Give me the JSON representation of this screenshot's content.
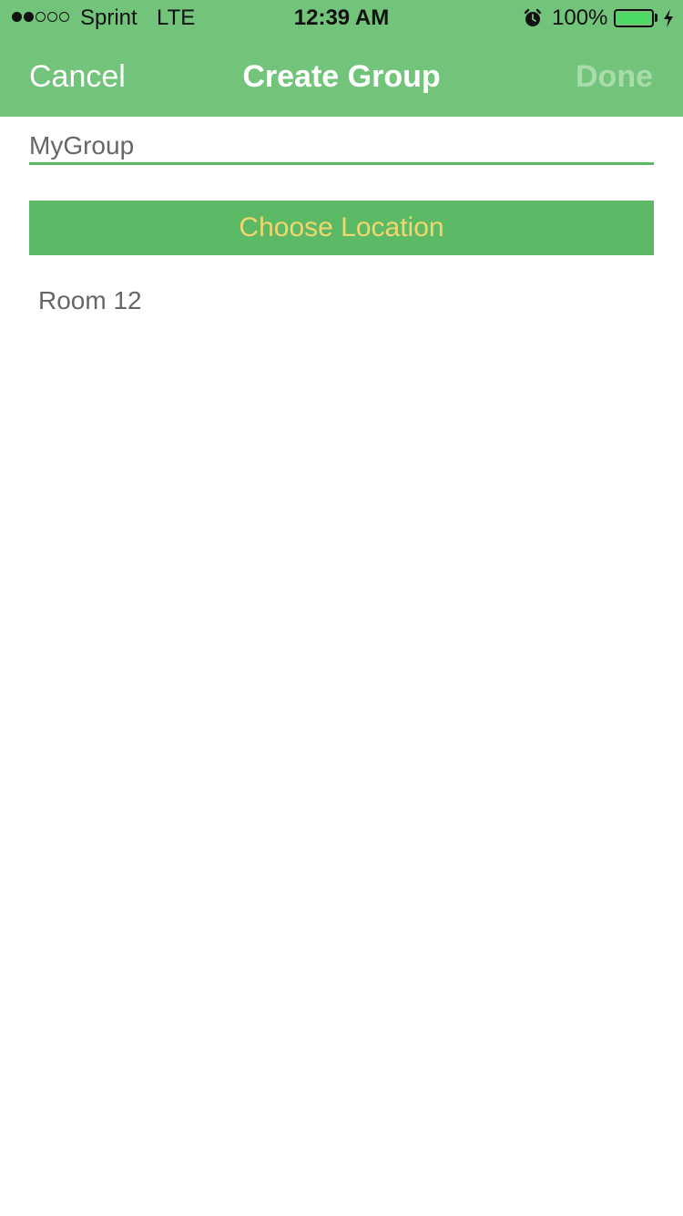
{
  "status_bar": {
    "carrier": "Sprint",
    "network": "LTE",
    "time": "12:39 AM",
    "battery_percent": "100%",
    "signal_strength": 2,
    "signal_max": 5,
    "battery_color": "#4cd964"
  },
  "nav": {
    "cancel_label": "Cancel",
    "title": "Create Group",
    "done_label": "Done",
    "background_color": "#72c47a"
  },
  "form": {
    "group_name_value": "MyGroup",
    "choose_location_label": "Choose Location",
    "selected_location": "Room 12"
  },
  "icons": {
    "alarm": "alarm-clock-icon",
    "charging": "charging-bolt-icon",
    "battery": "battery-icon"
  }
}
